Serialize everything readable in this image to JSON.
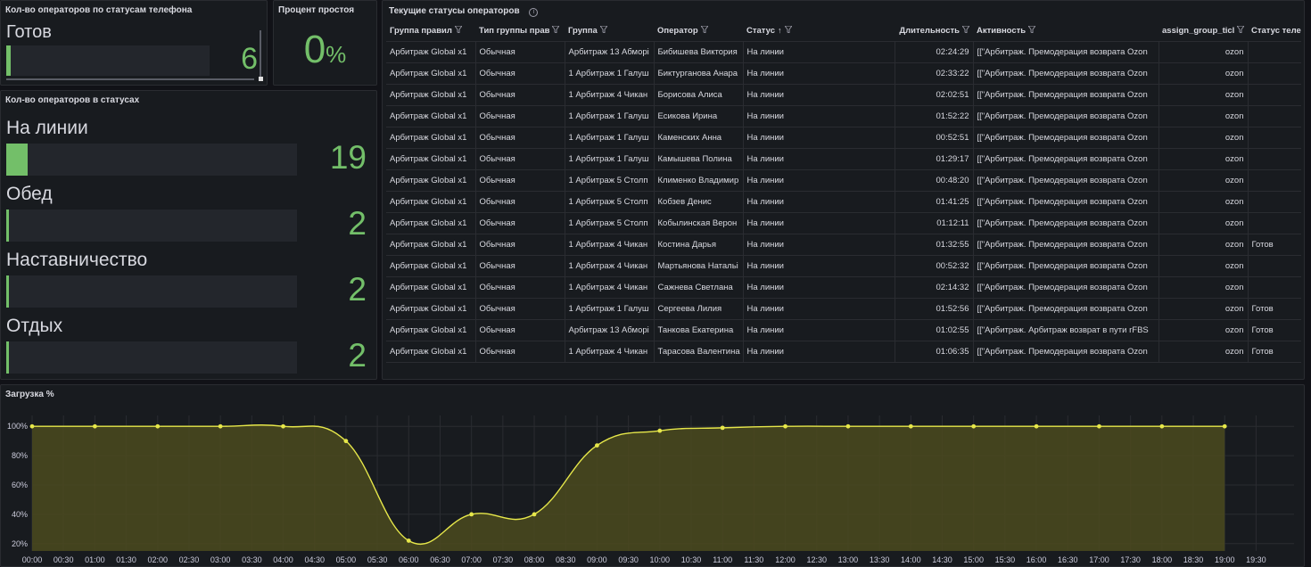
{
  "panel_phone": {
    "title": "Кол-во операторов по статусам телефона",
    "status_label": "Готов",
    "value": "6",
    "fill_fraction": 0.02
  },
  "panel_idle": {
    "title": "Процент простоя",
    "value": "0",
    "unit": "%"
  },
  "panel_status": {
    "title": "Кол-во операторов в статусах",
    "items": [
      {
        "label": "На линии",
        "value": "19",
        "fill_fraction": 0.075
      },
      {
        "label": "Обед",
        "value": "2",
        "fill_fraction": 0.01
      },
      {
        "label": "Наставничество",
        "value": "2",
        "fill_fraction": 0.01
      },
      {
        "label": "Отдых",
        "value": "2",
        "fill_fraction": 0.01
      }
    ]
  },
  "table_panel": {
    "title": "Текущие статусы операторов",
    "info_icon": "info-icon",
    "columns": [
      "Группа правил",
      "Тип группы прав",
      "Группа",
      "Оператор",
      "Статус",
      "Длительность",
      "Активность",
      "assign_group_ticl",
      "Статус теле"
    ],
    "sort_icon": "↑",
    "filter_icon": "filter-icon",
    "rows": [
      [
        "Арбитраж Global x1",
        "Обычная",
        "Арбитраж 13 Абморі",
        "Бибишева Виктория",
        "На линии",
        "02:24:29",
        "[[\"Арбитраж. Премодерация возврата Ozon",
        "ozon",
        ""
      ],
      [
        "Арбитраж Global x1",
        "Обычная",
        "1 Арбитраж 1 Галуш",
        "Биктурганова Анара",
        "На линии",
        "02:33:22",
        "[[\"Арбитраж. Премодерация возврата Ozon",
        "ozon",
        ""
      ],
      [
        "Арбитраж Global x1",
        "Обычная",
        "1 Арбитраж 4 Чикан",
        "Борисова Алиса",
        "На линии",
        "02:02:51",
        "[[\"Арбитраж. Премодерация возврата Ozon",
        "ozon",
        ""
      ],
      [
        "Арбитраж Global x1",
        "Обычная",
        "1 Арбитраж 1 Галуш",
        "Есикова Ирина",
        "На линии",
        "01:52:22",
        "[[\"Арбитраж. Премодерация возврата Ozon",
        "ozon",
        ""
      ],
      [
        "Арбитраж Global x1",
        "Обычная",
        "1 Арбитраж 1 Галуш",
        "Каменских Анна",
        "На линии",
        "00:52:51",
        "[[\"Арбитраж. Премодерация возврата Ozon",
        "ozon",
        ""
      ],
      [
        "Арбитраж Global x1",
        "Обычная",
        "1 Арбитраж 1 Галуш",
        "Камышева Полина",
        "На линии",
        "01:29:17",
        "[[\"Арбитраж. Премодерация возврата Ozon",
        "ozon",
        ""
      ],
      [
        "Арбитраж Global x1",
        "Обычная",
        "1 Арбитраж 5 Столп",
        "Клименко Владимир",
        "На линии",
        "00:48:20",
        "[[\"Арбитраж. Премодерация возврата Ozon",
        "ozon",
        ""
      ],
      [
        "Арбитраж Global x1",
        "Обычная",
        "1 Арбитраж 5 Столп",
        "Кобзев Денис",
        "На линии",
        "01:41:25",
        "[[\"Арбитраж. Премодерация возврата Ozon",
        "ozon",
        ""
      ],
      [
        "Арбитраж Global x1",
        "Обычная",
        "1 Арбитраж 5 Столп",
        "Кобылинская Верон",
        "На линии",
        "01:12:11",
        "[[\"Арбитраж. Премодерация возврата Ozon",
        "ozon",
        ""
      ],
      [
        "Арбитраж Global x1",
        "Обычная",
        "1 Арбитраж 4 Чикан",
        "Костина Дарья",
        "На линии",
        "01:32:55",
        "[[\"Арбитраж. Премодерация возврата Ozon",
        "ozon",
        "Готов"
      ],
      [
        "Арбитраж Global x1",
        "Обычная",
        "1 Арбитраж 4 Чикан",
        "Мартьянова Натальі",
        "На линии",
        "00:52:32",
        "[[\"Арбитраж. Премодерация возврата Ozon",
        "ozon",
        ""
      ],
      [
        "Арбитраж Global x1",
        "Обычная",
        "1 Арбитраж 4 Чикан",
        "Сажнева Светлана",
        "На линии",
        "02:14:32",
        "[[\"Арбитраж. Премодерация возврата Ozon",
        "ozon",
        ""
      ],
      [
        "Арбитраж Global x1",
        "Обычная",
        "1 Арбитраж 1 Галуш",
        "Сергеева Лилия",
        "На линии",
        "01:52:56",
        "[[\"Арбитраж. Премодерация возврата Ozon",
        "ozon",
        "Готов"
      ],
      [
        "Арбитраж Global x1",
        "Обычная",
        "Арбитраж 13 Абморі",
        "Танкова Екатерина",
        "На линии",
        "01:02:55",
        "[[\"Арбитраж. Арбитраж возврат в пути rFBS",
        "ozon",
        "Готов"
      ],
      [
        "Арбитраж Global x1",
        "Обычная",
        "1 Арбитраж 4 Чикан",
        "Тарасова Валентина",
        "На линии",
        "01:06:35",
        "[[\"Арбитраж. Премодерация возврата Ozon",
        "ozon",
        "Готов"
      ]
    ]
  },
  "chart_data": {
    "type": "area",
    "title": "Загрузка %",
    "x": [
      "00:00",
      "01:00",
      "02:00",
      "03:00",
      "04:00",
      "05:00",
      "06:00",
      "07:00",
      "08:00",
      "09:00",
      "10:00",
      "11:00",
      "12:00",
      "13:00",
      "14:00",
      "15:00",
      "16:00",
      "17:00",
      "18:00",
      "19:00"
    ],
    "xticks": [
      "00:00",
      "00:30",
      "01:00",
      "01:30",
      "02:00",
      "02:30",
      "03:00",
      "03:30",
      "04:00",
      "04:30",
      "05:00",
      "05:30",
      "06:00",
      "06:30",
      "07:00",
      "07:30",
      "08:00",
      "08:30",
      "09:00",
      "09:30",
      "10:00",
      "10:30",
      "11:00",
      "11:30",
      "12:00",
      "12:30",
      "13:00",
      "13:30",
      "14:00",
      "14:30",
      "15:00",
      "15:30",
      "16:00",
      "16:30",
      "17:00",
      "17:30",
      "18:00",
      "18:30",
      "19:00",
      "19:30"
    ],
    "series": [
      {
        "values": [
          100,
          100,
          100,
          100,
          100,
          90,
          22,
          40,
          40,
          87,
          97,
          99,
          100,
          100,
          100,
          100,
          100,
          100,
          100,
          100
        ]
      }
    ],
    "yticks": [
      "20%",
      "40%",
      "60%",
      "80%",
      "100%"
    ],
    "ylim": [
      15,
      105
    ],
    "xlim_hours": [
      0,
      19.75
    ],
    "line_color": "#e6e74a",
    "fill_color": "#4b4a1e",
    "grid": true
  },
  "colors": {
    "accent_green": "#73bf69",
    "bg": "#111217",
    "panel": "#181b1f"
  }
}
